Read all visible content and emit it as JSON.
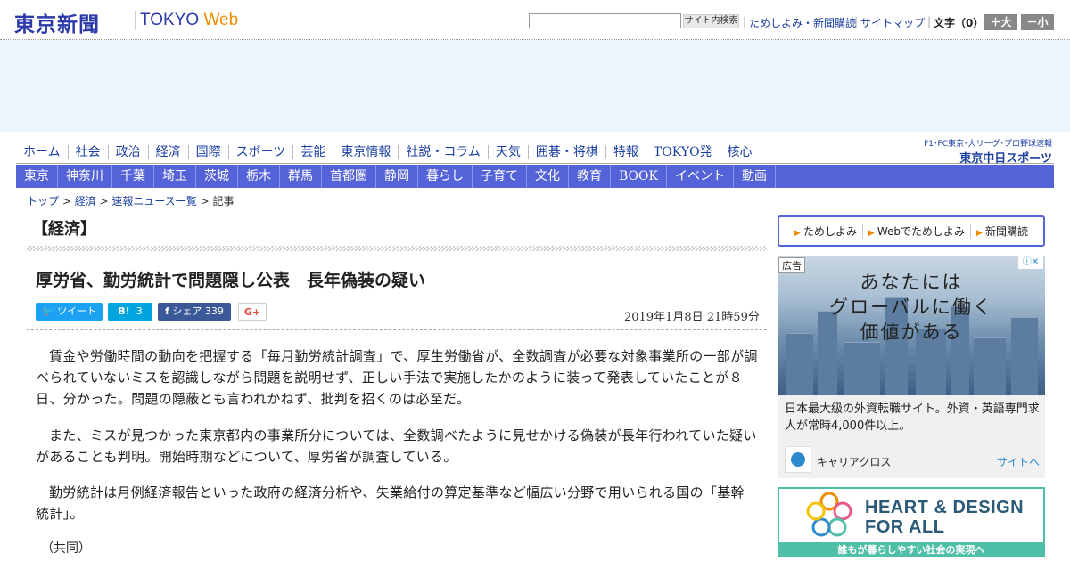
{
  "header": {
    "logo_text": "東京新聞",
    "logo_tokyo": "TOKYO",
    "logo_web": "Web",
    "search_button": "サイト内検索",
    "links": [
      "ためしよみ・新聞購読",
      "サイトマップ"
    ],
    "text_size_label": "文字（0）",
    "larger": "＋大",
    "smaller": "－小"
  },
  "nav_primary": [
    "ホーム",
    "社会",
    "政治",
    "経済",
    "国際",
    "スポーツ",
    "芸能",
    "東京情報",
    "社説・コラム",
    "天気",
    "囲碁・将棋",
    "特報",
    "TOKYO発",
    "核心"
  ],
  "chunichi": {
    "top": "F1･FC東京･大リーグ･プロ野球速報",
    "bottom": "東京中日スポーツ"
  },
  "nav_regional": [
    "東京",
    "神奈川",
    "千葉",
    "埼玉",
    "茨城",
    "栃木",
    "群馬",
    "首都圏",
    "静岡",
    "暮らし",
    "子育て",
    "文化",
    "教育",
    "BOOK",
    "イベント",
    "動画"
  ],
  "breadcrumb": {
    "items": [
      "トップ",
      "経済",
      "速報ニュース一覧"
    ],
    "current": "記事"
  },
  "article": {
    "category": "【経済】",
    "title": "厚労省、勤労統計で問題隠し公表　長年偽装の疑い",
    "share": {
      "tweet": "ツイート",
      "hatena": "B!",
      "hatena_count": "3",
      "fb": "シェア",
      "fb_count": "339",
      "gplus": "G+"
    },
    "date": "2019年1月8日 21時59分",
    "paragraphs": [
      "賃金や労働時間の動向を把握する「毎月勤労統計調査」で、厚生労働省が、全数調査が必要な対象事業所の一部が調べられていないミスを認識しながら問題を説明せず、正しい手法で実施したかのように装って発表していたことが８日、分かった。問題の隠蔽とも言われかねず、批判を招くのは必至だ。",
      "また、ミスが見つかった東京都内の事業所分については、全数調べたように見せかける偽装が長年行われていた疑いがあることも判明。開始時期などについて、厚労省が調査している。",
      "勤労統計は月例経済報告といった政府の経済分析や、失業給付の算定基準など幅広い分野で用いられる国の「基幹統計」。"
    ],
    "source": "（共同）"
  },
  "sidebar": {
    "links": [
      "ためしよみ",
      "Webでためしよみ",
      "新聞購読"
    ],
    "ad1": {
      "label": "広告",
      "info": "ⓘ✕",
      "headline": [
        "あなたには",
        "グローバルに働く",
        "価値がある"
      ],
      "text": "日本最大級の外資転職サイト。外資・英語専門求人が常時4,000件以上。",
      "brand": "キャリアクロス",
      "cta": "サイトへ"
    },
    "ad2": {
      "line1": "HEART & DESIGN",
      "line2": "FOR ALL",
      "band": "誰もが暮らしやすい社会の実現へ"
    }
  },
  "colors": {
    "brand": "#2b3aa8",
    "nav_bar": "#5563d9",
    "accent": "#f08c00",
    "ad2": "#4fbfa8"
  }
}
